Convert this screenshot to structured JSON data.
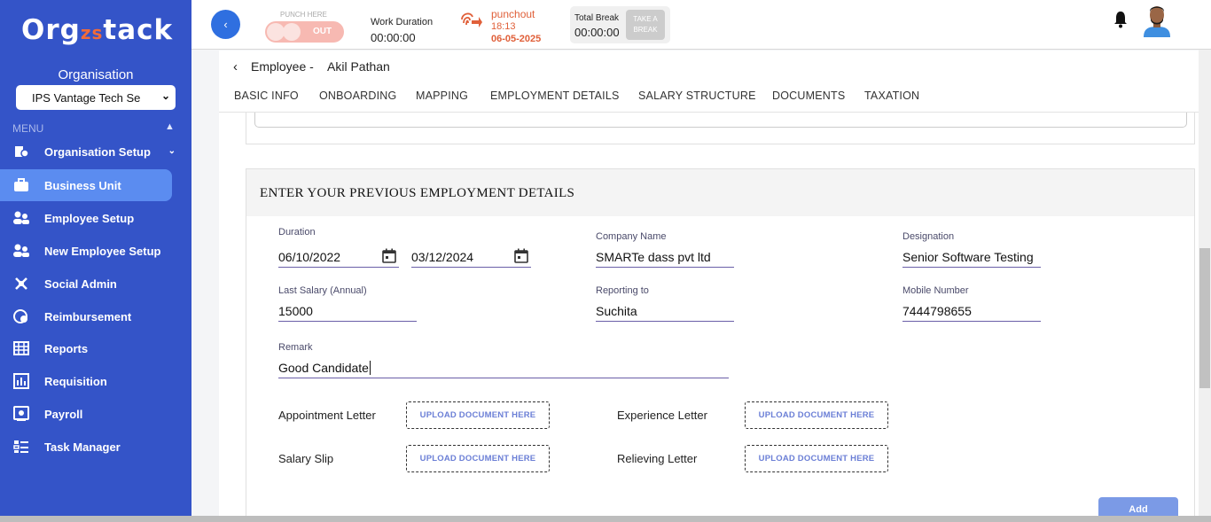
{
  "brand": {
    "logo_pre": "Org",
    "logo_mid": "zs",
    "logo_post": "tack"
  },
  "sidebar": {
    "org_label": "Organisation",
    "org_value": "IPS Vantage Tech Se",
    "menu_label": "MENU",
    "items": [
      {
        "label": "Organisation Setup",
        "icon": "org-setup-icon"
      },
      {
        "label": "Business Unit",
        "icon": "briefcase-icon",
        "active": true
      },
      {
        "label": "Employee Setup",
        "icon": "users-icon"
      },
      {
        "label": "New Employee Setup",
        "icon": "users-icon"
      },
      {
        "label": "Social Admin",
        "icon": "social-icon"
      },
      {
        "label": "Reimbursement",
        "icon": "reimbursement-icon"
      },
      {
        "label": "Reports",
        "icon": "reports-icon"
      },
      {
        "label": "Requisition",
        "icon": "requisition-icon"
      },
      {
        "label": "Payroll",
        "icon": "payroll-icon"
      },
      {
        "label": "Task Manager",
        "icon": "task-icon"
      }
    ]
  },
  "topbar": {
    "punch_here": "PUNCH HERE",
    "punch_state": "OUT",
    "work_duration_label": "Work Duration",
    "work_duration_value": "00:00:00",
    "punchout_label": "punchout",
    "punchout_time": "18:13",
    "punchout_date": "06-05-2025",
    "total_break_label": "Total Break",
    "total_break_value": "00:00:00",
    "take_break_line1": "TAKE A",
    "take_break_line2": "BREAK"
  },
  "breadcrumb": {
    "prefix": "Employee -",
    "name": "Akil Pathan"
  },
  "tabs": [
    "BASIC INFO",
    "ONBOARDING",
    "MAPPING",
    "EMPLOYMENT DETAILS",
    "SALARY STRUCTURE",
    "DOCUMENTS",
    "TAXATION"
  ],
  "form": {
    "title": "ENTER YOUR PREVIOUS EMPLOYMENT DETAILS",
    "duration_label": "Duration",
    "from_date": "06/10/2022",
    "to_date": "03/12/2024",
    "company_label": "Company Name",
    "company_value": "SMARTe dass pvt ltd",
    "designation_label": "Designation",
    "designation_value": "Senior Software Testing",
    "salary_label": "Last Salary (Annual)",
    "salary_value": "15000",
    "reporting_label": "Reporting to",
    "reporting_value": "Suchita",
    "mobile_label": "Mobile Number",
    "mobile_value": "7444798655",
    "remark_label": "Remark",
    "remark_value": "Good Candidate",
    "documents": {
      "appointment": "Appointment Letter",
      "experience": "Experience Letter",
      "salary_slip": "Salary Slip",
      "relieving": "Relieving Letter",
      "upload_label": "UPLOAD DOCUMENT HERE"
    },
    "add_label": "Add"
  }
}
